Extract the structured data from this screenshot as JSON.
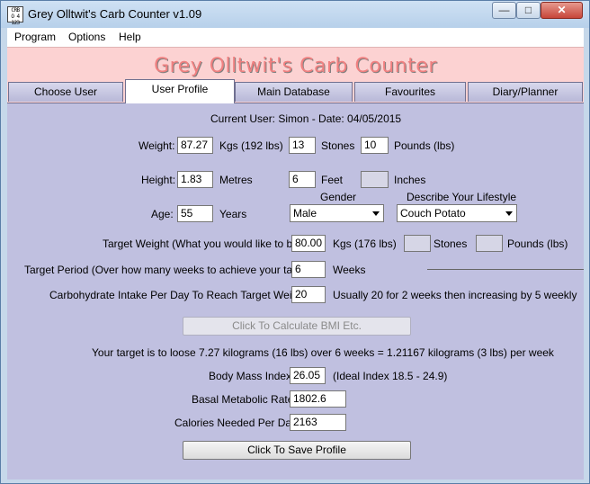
{
  "window": {
    "title": "Grey Olltwit's Carb Counter v1.09",
    "icon_text": "CRB\nO 4\n123",
    "minimize_glyph": "—",
    "maximize_glyph": "□",
    "close_glyph": "✕"
  },
  "menu": {
    "items": [
      "Program",
      "Options",
      "Help"
    ]
  },
  "banner": {
    "title": "Grey Olltwit's Carb Counter"
  },
  "tabs": [
    "Choose User",
    "User Profile",
    "Main Database",
    "Favourites",
    "Diary/Planner"
  ],
  "active_tab": "User Profile",
  "profile": {
    "current_user": "Current User: Simon - Date: 04/05/2015",
    "weight_label": "Weight:",
    "weight_value": "87.27",
    "kgs_label": "Kgs (192 lbs)",
    "stones_value": "13",
    "stones_label": "Stones",
    "pounds_value": "10",
    "pounds_label": "Pounds (lbs)",
    "height_label": "Height:",
    "height_value": "1.83",
    "metres_label": "Metres",
    "feet_value": "6",
    "feet_label": "Feet",
    "inches_value": "",
    "inches_label": "Inches",
    "gender_label": "Gender",
    "lifestyle_label": "Describe Your Lifestyle",
    "age_label": "Age:",
    "age_value": "55",
    "years_label": "Years",
    "gender_value": "Male",
    "lifestyle_value": "Couch Potato",
    "target_weight_label": "Target Weight (What you would like to be):",
    "target_weight_value": "80.00",
    "target_kgs_label": "Kgs (176 lbs)",
    "target_stones_value": "",
    "target_stones_label": "Stones",
    "target_pounds_value": "",
    "target_pounds_label": "Pounds (lbs)",
    "target_period_label": "Target Period (Over how many weeks to achieve your target):",
    "target_period_value": "6",
    "weeks_label": "Weeks",
    "carb_label": "Carbohydrate Intake Per Day To Reach Target Weight:",
    "carb_value": "20",
    "carb_note": "Usually 20 for 2 weeks then increasing by 5 weekly",
    "calc_button": "Click To Calculate BMI Etc.",
    "target_summary": "Your target is to loose 7.27 kilograms (16 lbs) over 6 weeks = 1.21167 kilograms (3 lbs) per week",
    "bmi_label": "Body Mass Index:",
    "bmi_value": "26.05",
    "bmi_note": "(Ideal Index 18.5 - 24.9)",
    "bmr_label": "Basal Metabolic Rate:",
    "bmr_value": "1802.6",
    "calories_label": "Calories Needed Per Day:",
    "calories_value": "2163",
    "save_button": "Click To Save Profile"
  }
}
